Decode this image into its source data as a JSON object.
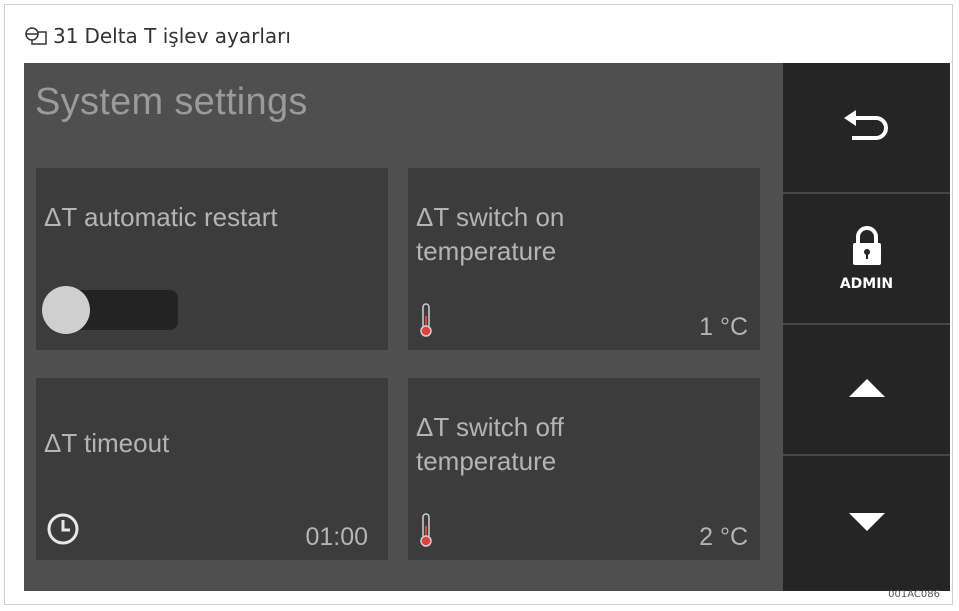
{
  "caption": {
    "figure_icon": "figure-reference-icon",
    "number": "31",
    "text": "Delta T işlev ayarları"
  },
  "screen": {
    "title": "System settings",
    "tiles": [
      {
        "label": "ΔT automatic restart",
        "control": "toggle",
        "toggle_on": false
      },
      {
        "label": "ΔT switch on temperature",
        "icon": "thermometer-icon",
        "value": "1 °C"
      },
      {
        "label": "ΔT timeout",
        "icon": "clock-icon",
        "value": "01:00"
      },
      {
        "label": "ΔT switch off temperature",
        "icon": "thermometer-icon",
        "value": "2 °C"
      }
    ]
  },
  "sidebar": {
    "back_icon": "back-arrow-icon",
    "admin_icon": "padlock-icon",
    "admin_label": "ADMIN",
    "up_icon": "triangle-up-icon",
    "down_icon": "triangle-down-icon"
  },
  "colors": {
    "screen_bg": "#4f4f4f",
    "tile_bg": "#3c3c3c",
    "sidebar_bg": "#252525",
    "text": "#b4b4b4",
    "thermometer_red": "#e0413a"
  },
  "reference_code": "001AC086"
}
